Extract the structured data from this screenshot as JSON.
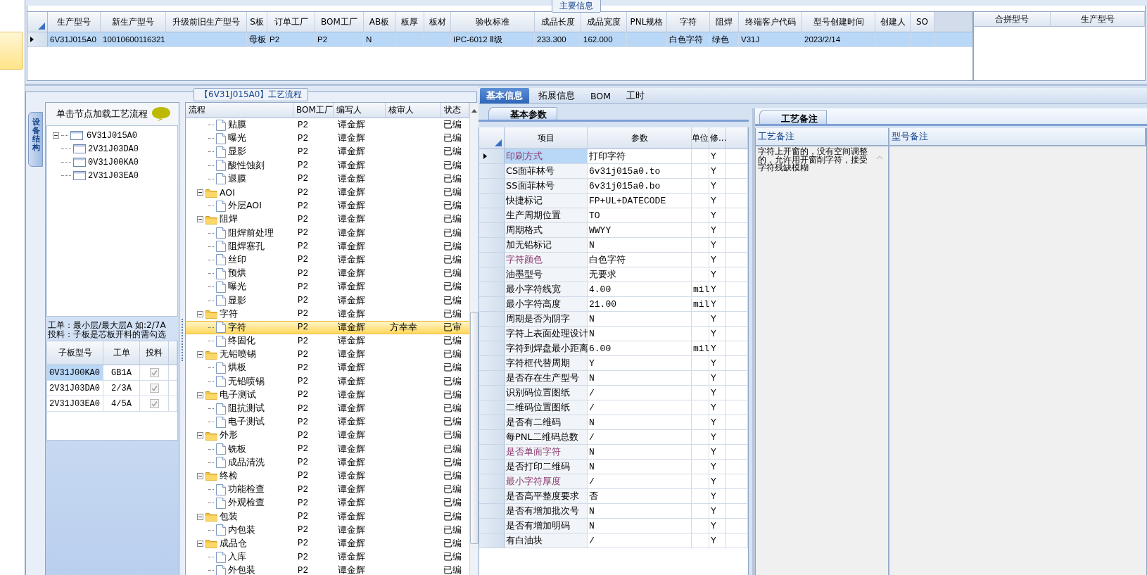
{
  "main_info": {
    "title": "主要信息",
    "columns": [
      "生产型号",
      "新生产型号",
      "升级前旧生产型号",
      "S板",
      "订单工厂",
      "BOM工厂",
      "AB板",
      "板厚",
      "板材",
      "验收标准",
      "成品长度",
      "成品宽度",
      "PNL规格",
      "字符",
      "阻焊",
      "终端客户代码",
      "型号创建时间",
      "创建人",
      "SO"
    ],
    "rows": [
      {
        "selected": true,
        "cells": [
          "6V31J015A0",
          "10010600116321",
          null,
          "母板",
          "P2",
          "P2",
          "N",
          null,
          null,
          "IPC-6012 Ⅱ级",
          "233.300",
          "162.000",
          null,
          "白色字符",
          "绿色",
          "V31J",
          "2023/2/14",
          null,
          null
        ]
      }
    ],
    "merge_columns": [
      "合拼型号",
      "生产型号"
    ]
  },
  "flow_panel": {
    "title": "【6V31J015A0】工艺流程",
    "side_tab": "设备结构",
    "hint": "单击节点加载工艺流程",
    "board_tree": [
      {
        "label": "6V31J015A0",
        "expanded": true,
        "children": [
          {
            "label": "2V31J03DA0"
          },
          {
            "label": "0V31J00KA0"
          },
          {
            "label": "2V31J03EA0"
          }
        ]
      }
    ],
    "notes": [
      "工单：最小层/最大层A 如:2/7A",
      "投料：子板是芯板开料的需勾选"
    ],
    "sub_boards": {
      "columns": [
        "子板型号",
        "工单",
        "投料"
      ],
      "rows": [
        {
          "board": "0V31J00KA0",
          "order": "GB1A",
          "checked": true,
          "selected": true
        },
        {
          "board": "2V31J03DA0",
          "order": "2/3A",
          "checked": true,
          "selected": false
        },
        {
          "board": "2V31J03EA0",
          "order": "4/5A",
          "checked": true,
          "selected": false
        }
      ]
    },
    "flow_grid": {
      "columns": [
        "流程",
        "BOM工厂",
        "编写人",
        "核审人",
        "状态"
      ],
      "continued_group": {
        "children": [
          {
            "label": "贴膜",
            "bom": "P2",
            "author": "谭金辉",
            "status": "已编",
            "selected": false
          },
          {
            "label": "曝光",
            "bom": "P2",
            "author": "谭金辉",
            "status": "已编",
            "selected": false
          },
          {
            "label": "显影",
            "bom": "P2",
            "author": "谭金辉",
            "status": "已编",
            "selected": false
          },
          {
            "label": "酸性蚀刻",
            "bom": "P2",
            "author": "谭金辉",
            "status": "已编",
            "selected": false
          },
          {
            "label": "退膜",
            "bom": "P2",
            "author": "谭金辉",
            "status": "已编",
            "selected": false
          }
        ]
      },
      "rows": [
        {
          "label": "AOI",
          "bom": "P2",
          "author": "谭金辉",
          "status": "已编",
          "selected": false,
          "expanded": true,
          "children": [
            {
              "label": "外层AOI",
              "bom": "P2",
              "author": "谭金辉",
              "status": "已编",
              "selected": false
            }
          ]
        },
        {
          "label": "阻焊",
          "bom": "P2",
          "author": "谭金辉",
          "status": "已编",
          "selected": false,
          "expanded": true,
          "children": [
            {
              "label": "阻焊前处理",
              "bom": "P2",
              "author": "谭金辉",
              "status": "已编",
              "selected": false
            },
            {
              "label": "阻焊塞孔",
              "bom": "P2",
              "author": "谭金辉",
              "status": "已编",
              "selected": false
            },
            {
              "label": "丝印",
              "bom": "P2",
              "author": "谭金辉",
              "status": "已编",
              "selected": false
            },
            {
              "label": "预烘",
              "bom": "P2",
              "author": "谭金辉",
              "status": "已编",
              "selected": false
            },
            {
              "label": "曝光",
              "bom": "P2",
              "author": "谭金辉",
              "status": "已编",
              "selected": false
            },
            {
              "label": "显影",
              "bom": "P2",
              "author": "谭金辉",
              "status": "已编",
              "selected": false
            }
          ]
        },
        {
          "label": "字符",
          "bom": "P2",
          "author": "谭金辉",
          "status": "已编",
          "selected": false,
          "expanded": true,
          "children": [
            {
              "label": "字符",
              "bom": "P2",
              "author": "谭金辉",
              "reviewer": "方幸幸",
              "status": "已审",
              "selected": true
            },
            {
              "label": "终固化",
              "bom": "P2",
              "author": "谭金辉",
              "status": "已编",
              "selected": false
            }
          ]
        },
        {
          "label": "无铅喷锡",
          "bom": "P2",
          "author": "谭金辉",
          "status": "已编",
          "selected": false,
          "expanded": true,
          "children": [
            {
              "label": "烘板",
              "bom": "P2",
              "author": "谭金辉",
              "status": "已编",
              "selected": false
            },
            {
              "label": "无铅喷锡",
              "bom": "P2",
              "author": "谭金辉",
              "status": "已编",
              "selected": false
            }
          ]
        },
        {
          "label": "电子测试",
          "bom": "P2",
          "author": "谭金辉",
          "status": "已编",
          "selected": false,
          "expanded": true,
          "children": [
            {
              "label": "阻抗测试",
              "bom": "P2",
              "author": "谭金辉",
              "status": "已编",
              "selected": false
            },
            {
              "label": "电子测试",
              "bom": "P2",
              "author": "谭金辉",
              "status": "已编",
              "selected": false
            }
          ]
        },
        {
          "label": "外形",
          "bom": "P2",
          "author": "谭金辉",
          "status": "已编",
          "selected": false,
          "expanded": true,
          "children": [
            {
              "label": "铣板",
              "bom": "P2",
              "author": "谭金辉",
              "status": "已编",
              "selected": false
            },
            {
              "label": "成品清洗",
              "bom": "P2",
              "author": "谭金辉",
              "status": "已编",
              "selected": false
            }
          ]
        },
        {
          "label": "终检",
          "bom": "P2",
          "author": "谭金辉",
          "status": "已编",
          "selected": false,
          "expanded": true,
          "children": [
            {
              "label": "功能检查",
              "bom": "P2",
              "author": "谭金辉",
              "status": "已编",
              "selected": false
            },
            {
              "label": "外观检查",
              "bom": "P2",
              "author": "谭金辉",
              "status": "已编",
              "selected": false
            }
          ]
        },
        {
          "label": "包装",
          "bom": "P2",
          "author": "谭金辉",
          "status": "已编",
          "selected": false,
          "expanded": true,
          "children": [
            {
              "label": "内包装",
              "bom": "P2",
              "author": "谭金辉",
              "status": "已编",
              "selected": false
            }
          ]
        },
        {
          "label": "成品仓",
          "bom": "P2",
          "author": "谭金辉",
          "status": "已编",
          "selected": false,
          "expanded": true,
          "children": [
            {
              "label": "入库",
              "bom": "P2",
              "author": "谭金辉",
              "status": "已编",
              "selected": false
            },
            {
              "label": "外包装",
              "bom": "P2",
              "author": "谭金辉",
              "status": "已编",
              "selected": false
            }
          ]
        }
      ]
    }
  },
  "detail_tabs": [
    {
      "label": "基本信息",
      "selected": true
    },
    {
      "label": "拓展信息",
      "selected": false
    },
    {
      "label": "BOM",
      "selected": false
    },
    {
      "label": "工时",
      "selected": false
    }
  ],
  "params": {
    "title": "基本参数",
    "columns": [
      "项目",
      "参数",
      "单位",
      "修..."
    ],
    "rows": [
      {
        "item": "印刷方式",
        "value": "打印字符",
        "flag": "Y",
        "emphasized": true,
        "selected": true
      },
      {
        "item": "CS面菲林号",
        "value": "6v31j015a0.to",
        "flag": "Y",
        "emphasized": false,
        "selected": false
      },
      {
        "item": "SS面菲林号",
        "value": "6v31j015a0.bo",
        "flag": "Y",
        "emphasized": false,
        "selected": false
      },
      {
        "item": "快捷标记",
        "value": "FP+UL+DATECODE",
        "flag": "Y",
        "emphasized": false,
        "selected": false
      },
      {
        "item": "生产周期位置",
        "value": "TO",
        "flag": "Y",
        "emphasized": false,
        "selected": false
      },
      {
        "item": "周期格式",
        "value": "WWYY",
        "flag": "Y",
        "emphasized": false,
        "selected": false
      },
      {
        "item": "加无铅标记",
        "value": "N",
        "flag": "Y",
        "emphasized": false,
        "selected": false
      },
      {
        "item": "字符颜色",
        "value": "白色字符",
        "flag": "Y",
        "emphasized": true,
        "selected": false
      },
      {
        "item": "油墨型号",
        "value": "无要求",
        "flag": "Y",
        "emphasized": false,
        "selected": false
      },
      {
        "item": "最小字符线宽",
        "value": "4.00",
        "unit": "mil",
        "flag": "Y",
        "emphasized": false,
        "selected": false
      },
      {
        "item": "最小字符高度",
        "value": "21.00",
        "unit": "mil",
        "flag": "Y",
        "emphasized": false,
        "selected": false
      },
      {
        "item": "周期是否为阴字",
        "value": "N",
        "flag": "Y",
        "emphasized": false,
        "selected": false
      },
      {
        "item": "字符上表面处理设计",
        "value": "N",
        "flag": "Y",
        "emphasized": false,
        "selected": false
      },
      {
        "item": "字符到焊盘最小距离",
        "value": "6.00",
        "unit": "mil",
        "flag": "Y",
        "emphasized": false,
        "selected": false
      },
      {
        "item": "字符框代替周期",
        "value": "Y",
        "flag": "Y",
        "emphasized": false,
        "selected": false
      },
      {
        "item": "是否存在生产型号",
        "value": "N",
        "flag": "Y",
        "emphasized": false,
        "selected": false
      },
      {
        "item": "识别码位置图纸",
        "value": "/",
        "flag": "Y",
        "emphasized": false,
        "selected": false
      },
      {
        "item": "二维码位置图纸",
        "value": "/",
        "flag": "Y",
        "emphasized": false,
        "selected": false
      },
      {
        "item": "是否有二维码",
        "value": "N",
        "flag": "Y",
        "emphasized": false,
        "selected": false
      },
      {
        "item": "每PNL二维码总数",
        "value": "/",
        "flag": "Y",
        "emphasized": false,
        "selected": false
      },
      {
        "item": "是否单面字符",
        "value": "N",
        "flag": "Y",
        "emphasized": true,
        "selected": false
      },
      {
        "item": "是否打印二维码",
        "value": "N",
        "flag": "Y",
        "emphasized": false,
        "selected": false
      },
      {
        "item": "最小字符厚度",
        "value": "/",
        "flag": "Y",
        "emphasized": true,
        "selected": false
      },
      {
        "item": "是否高平整度要求",
        "value": "否",
        "flag": "Y",
        "emphasized": false,
        "selected": false
      },
      {
        "item": "是否有增加批次号",
        "value": "N",
        "flag": "Y",
        "emphasized": false,
        "selected": false
      },
      {
        "item": "是否有增加明码",
        "value": "N",
        "flag": "Y",
        "emphasized": false,
        "selected": false
      },
      {
        "item": "有白油块",
        "value": "/",
        "flag": "Y",
        "emphasized": false,
        "selected": false
      }
    ]
  },
  "notes_panel": {
    "title": "工艺备注",
    "columns": [
      "工艺备注",
      "型号备注"
    ],
    "process_note": "字符上开窗的，没有空间调整的，允许用开窗削字符，接受字符残缺模糊"
  }
}
